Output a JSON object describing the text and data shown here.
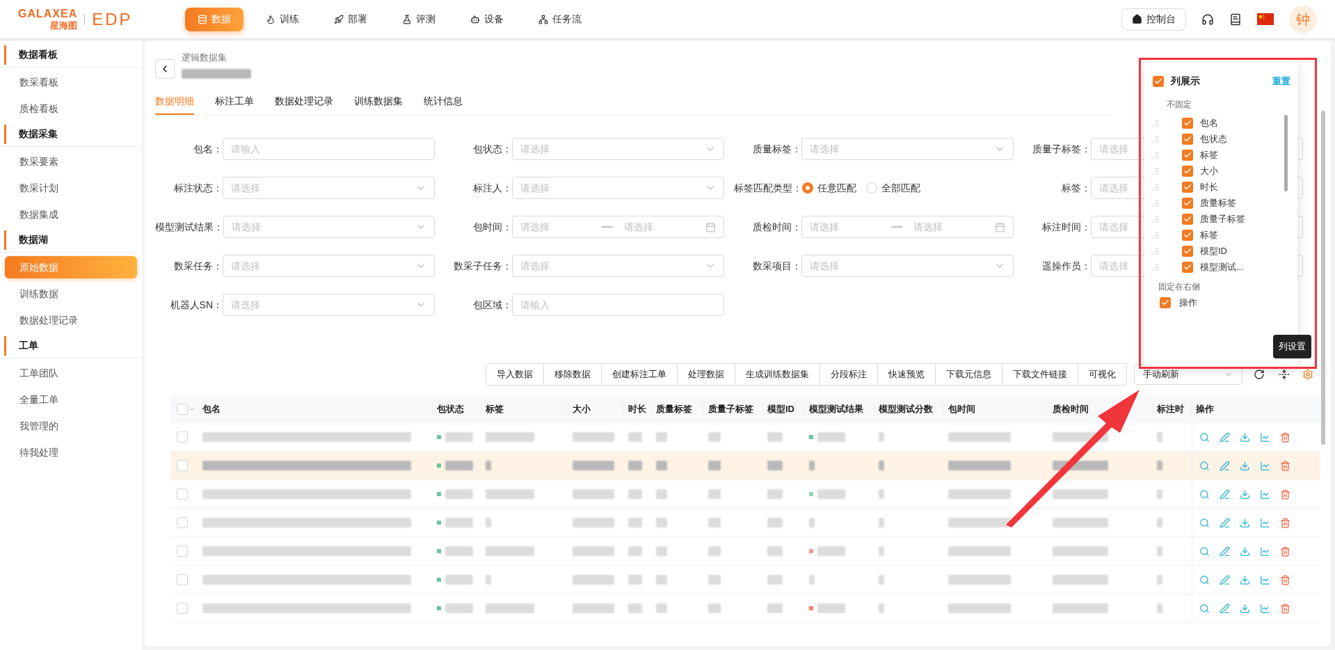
{
  "header": {
    "logo": {
      "brand": "GALAXEA",
      "brand_cn": "星海图",
      "product": "EDP"
    },
    "nav": [
      {
        "label": "数据",
        "selected": true
      },
      {
        "label": "训练",
        "selected": false
      },
      {
        "label": "部署",
        "selected": false
      },
      {
        "label": "评测",
        "selected": false
      },
      {
        "label": "设备",
        "selected": false
      },
      {
        "label": "任务流",
        "selected": false
      }
    ],
    "console_button": "控制台",
    "avatar": "钟"
  },
  "sidebar": {
    "sections": [
      {
        "title": "数据看板",
        "items": [
          {
            "label": "数采看板",
            "selected": false
          },
          {
            "label": "质检看板",
            "selected": false
          }
        ]
      },
      {
        "title": "数据采集",
        "items": [
          {
            "label": "数采要素",
            "selected": false
          },
          {
            "label": "数采计划",
            "selected": false
          },
          {
            "label": "数据集成",
            "selected": false
          }
        ]
      },
      {
        "title": "数据湖",
        "items": [
          {
            "label": "原始数据",
            "selected": true
          },
          {
            "label": "训练数据",
            "selected": false
          },
          {
            "label": "数据处理记录",
            "selected": false
          }
        ]
      },
      {
        "title": "工单",
        "items": [
          {
            "label": "工单团队",
            "selected": false
          },
          {
            "label": "全量工单",
            "selected": false
          },
          {
            "label": "我管理的",
            "selected": false
          },
          {
            "label": "待我处理",
            "selected": false
          }
        ]
      }
    ]
  },
  "breadcrumb": {
    "parent": "逻辑数据集"
  },
  "tabs": [
    {
      "label": "数据明细",
      "selected": true
    },
    {
      "label": "标注工单",
      "selected": false
    },
    {
      "label": "数据处理记录",
      "selected": false
    },
    {
      "label": "训练数据集",
      "selected": false
    },
    {
      "label": "统计信息",
      "selected": false
    }
  ],
  "filters": [
    {
      "label": "包名：",
      "kind": "input",
      "placeholder": "请输入"
    },
    {
      "label": "包状态：",
      "kind": "select",
      "placeholder": "请选择"
    },
    {
      "label": "质量标签：",
      "kind": "select",
      "placeholder": "请选择"
    },
    {
      "label": "质量子标签：",
      "kind": "select",
      "placeholder": "请选择"
    },
    {
      "label": "标注状态：",
      "kind": "select",
      "placeholder": "请选择"
    },
    {
      "label": "标注人：",
      "kind": "select",
      "placeholder": "请选择"
    },
    {
      "label": "标签匹配类型：",
      "kind": "radio",
      "options": [
        {
          "label": "任意匹配",
          "selected": true
        },
        {
          "label": "全部匹配",
          "selected": false
        }
      ]
    },
    {
      "label": "标签：",
      "kind": "select",
      "placeholder": "请选择"
    },
    {
      "label": "模型测试结果：",
      "kind": "select",
      "placeholder": "请选择"
    },
    {
      "label": "包时间：",
      "kind": "range",
      "placeholder": "请选择",
      "placeholder_end": "请选择"
    },
    {
      "label": "质检时间：",
      "kind": "range",
      "placeholder": "请选择",
      "placeholder_end": "请选择"
    },
    {
      "label": "标注时间：",
      "kind": "select",
      "placeholder": "请选择"
    },
    {
      "label": "数采任务：",
      "kind": "select",
      "placeholder": "请选择"
    },
    {
      "label": "数采子任务：",
      "kind": "select",
      "placeholder": "请选择"
    },
    {
      "label": "数采项目：",
      "kind": "select",
      "placeholder": "请选择"
    },
    {
      "label": "遥操作员：",
      "kind": "select",
      "placeholder": "请选择"
    },
    {
      "label": "机器人SN：",
      "kind": "select",
      "placeholder": "请选择"
    },
    {
      "label": "包区域：",
      "kind": "input",
      "placeholder": "请输入"
    }
  ],
  "toolbar": {
    "buttons": [
      "导入数据",
      "移除数据",
      "创建标注工单",
      "处理数据",
      "生成训练数据集",
      "分段标注",
      "快速预览",
      "下载元信息",
      "下载文件链接",
      "可视化"
    ],
    "refresh_select": "手动刷新"
  },
  "table": {
    "columns": [
      "包名",
      "包状态",
      "标签",
      "大小",
      "时长",
      "质量标签",
      "质量子标签",
      "模型ID",
      "模型测试结果",
      "模型测试分数",
      "包时间",
      "质检时间",
      "标注时",
      "操作"
    ],
    "select_all": false,
    "rows": [
      {
        "selected": false,
        "checked": false,
        "color": "#6cc79a"
      },
      {
        "selected": true,
        "checked": false
      },
      {
        "selected": false,
        "checked": false,
        "color": "#8fd6b3"
      },
      {
        "selected": false,
        "checked": false
      },
      {
        "selected": false,
        "checked": false,
        "color": "#f59a8a"
      },
      {
        "selected": false,
        "checked": false
      },
      {
        "selected": false,
        "checked": false,
        "color": "#f4806c"
      }
    ]
  },
  "column_settings": {
    "title": "列展示",
    "checked": true,
    "reset": "重置",
    "unfixed_label": "不固定",
    "unfixed": [
      {
        "label": "包名",
        "checked": true
      },
      {
        "label": "包状态",
        "checked": true
      },
      {
        "label": "标签",
        "checked": true
      },
      {
        "label": "大小",
        "checked": true
      },
      {
        "label": "时长",
        "checked": true
      },
      {
        "label": "质量标签",
        "checked": true
      },
      {
        "label": "质量子标签",
        "checked": true
      },
      {
        "label": "标签",
        "checked": true
      },
      {
        "label": "模型ID",
        "checked": true
      },
      {
        "label": "模型测试...",
        "checked": true
      }
    ],
    "fixed_label": "固定在右侧",
    "fixed": [
      {
        "label": "操作",
        "checked": true
      }
    ]
  },
  "tooltip": "列设置"
}
